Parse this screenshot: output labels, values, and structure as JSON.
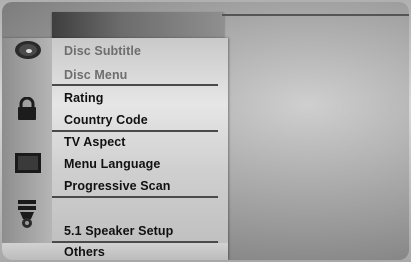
{
  "menu": {
    "items": [
      {
        "label": "Disc Subtitle",
        "state": "dim"
      },
      {
        "label": "Disc Menu",
        "state": "dim"
      },
      {
        "label": "Rating",
        "state": "normal"
      },
      {
        "label": "Country Code",
        "state": "normal"
      },
      {
        "label": "TV Aspect",
        "state": "normal"
      },
      {
        "label": "Menu Language",
        "state": "normal"
      },
      {
        "label": "Progressive Scan",
        "state": "normal"
      },
      {
        "label": "5.1 Speaker Setup",
        "state": "normal"
      },
      {
        "label": "Others",
        "state": "normal"
      }
    ],
    "icons": [
      "disc-icon",
      "lock-icon",
      "screen-icon",
      "speaker-icon"
    ]
  }
}
